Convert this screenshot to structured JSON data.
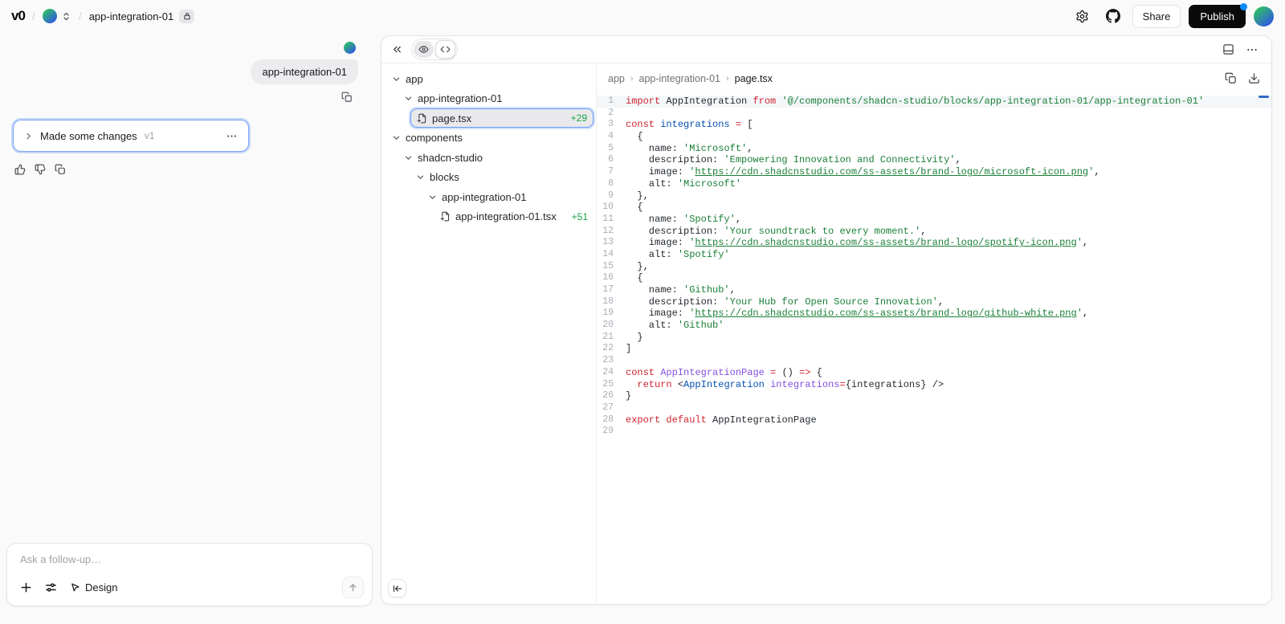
{
  "topbar": {
    "logo": "v0",
    "slash": "/",
    "project_name": "app-integration-01",
    "share_label": "Share",
    "publish_label": "Publish"
  },
  "chat": {
    "user_message": "app-integration-01",
    "version_card": {
      "title": "Made some changes",
      "version": "v1"
    },
    "composer": {
      "placeholder": "Ask a follow-up…",
      "design_label": "Design"
    }
  },
  "workspace": {
    "tree": [
      {
        "label": "app",
        "type": "folder",
        "depth": 0
      },
      {
        "label": "app-integration-01",
        "type": "folder",
        "depth": 1
      },
      {
        "label": "page.tsx",
        "type": "file",
        "depth": 2,
        "badge": "+29",
        "selected": true
      },
      {
        "label": "components",
        "type": "folder",
        "depth": 0
      },
      {
        "label": "shadcn-studio",
        "type": "folder",
        "depth": 1
      },
      {
        "label": "blocks",
        "type": "folder",
        "depth": 2
      },
      {
        "label": "app-integration-01",
        "type": "folder",
        "depth": 3
      },
      {
        "label": "app-integration-01.tsx",
        "type": "file",
        "depth": 4,
        "badge": "+51",
        "selected": false
      }
    ],
    "breadcrumb": {
      "segments": [
        "app",
        "app-integration-01",
        "page.tsx"
      ],
      "separator": "›"
    },
    "code": {
      "lines": [
        [
          [
            "k",
            "import"
          ],
          [
            "p",
            " AppIntegration "
          ],
          [
            "k",
            "from"
          ],
          [
            "p",
            " "
          ],
          [
            "s",
            "'@/components/shadcn-studio/blocks/app-integration-01/app-integration-01'"
          ]
        ],
        [],
        [
          [
            "k",
            "const"
          ],
          [
            "p",
            " "
          ],
          [
            "v",
            "integrations"
          ],
          [
            "p",
            " "
          ],
          [
            "k",
            "="
          ],
          [
            "p",
            " ["
          ]
        ],
        [
          [
            "p",
            "  {"
          ]
        ],
        [
          [
            "p",
            "    name: "
          ],
          [
            "s",
            "'Microsoft'"
          ],
          [
            "p",
            ","
          ]
        ],
        [
          [
            "p",
            "    description: "
          ],
          [
            "s",
            "'Empowering Innovation and Connectivity'"
          ],
          [
            "p",
            ","
          ]
        ],
        [
          [
            "p",
            "    image: "
          ],
          [
            "s",
            "'"
          ],
          [
            "u",
            "https://cdn.shadcnstudio.com/ss-assets/brand-logo/microsoft-icon.png"
          ],
          [
            "s",
            "'"
          ],
          [
            "p",
            ","
          ]
        ],
        [
          [
            "p",
            "    alt: "
          ],
          [
            "s",
            "'Microsoft'"
          ]
        ],
        [
          [
            "p",
            "  },"
          ]
        ],
        [
          [
            "p",
            "  {"
          ]
        ],
        [
          [
            "p",
            "    name: "
          ],
          [
            "s",
            "'Spotify'"
          ],
          [
            "p",
            ","
          ]
        ],
        [
          [
            "p",
            "    description: "
          ],
          [
            "s",
            "'Your soundtrack to every moment.'"
          ],
          [
            "p",
            ","
          ]
        ],
        [
          [
            "p",
            "    image: "
          ],
          [
            "s",
            "'"
          ],
          [
            "u",
            "https://cdn.shadcnstudio.com/ss-assets/brand-logo/spotify-icon.png"
          ],
          [
            "s",
            "'"
          ],
          [
            "p",
            ","
          ]
        ],
        [
          [
            "p",
            "    alt: "
          ],
          [
            "s",
            "'Spotify'"
          ]
        ],
        [
          [
            "p",
            "  },"
          ]
        ],
        [
          [
            "p",
            "  {"
          ]
        ],
        [
          [
            "p",
            "    name: "
          ],
          [
            "s",
            "'Github'"
          ],
          [
            "p",
            ","
          ]
        ],
        [
          [
            "p",
            "    description: "
          ],
          [
            "s",
            "'Your Hub for Open Source Innovation'"
          ],
          [
            "p",
            ","
          ]
        ],
        [
          [
            "p",
            "    image: "
          ],
          [
            "s",
            "'"
          ],
          [
            "u",
            "https://cdn.shadcnstudio.com/ss-assets/brand-logo/github-white.png"
          ],
          [
            "s",
            "'"
          ],
          [
            "p",
            ","
          ]
        ],
        [
          [
            "p",
            "    alt: "
          ],
          [
            "s",
            "'Github'"
          ]
        ],
        [
          [
            "p",
            "  }"
          ]
        ],
        [
          [
            "p",
            "]"
          ]
        ],
        [],
        [
          [
            "k",
            "const"
          ],
          [
            "p",
            " "
          ],
          [
            "f",
            "AppIntegrationPage"
          ],
          [
            "p",
            " "
          ],
          [
            "k",
            "="
          ],
          [
            "p",
            " () "
          ],
          [
            "k",
            "=>"
          ],
          [
            "p",
            " {"
          ]
        ],
        [
          [
            "p",
            "  "
          ],
          [
            "k",
            "return"
          ],
          [
            "p",
            " <"
          ],
          [
            "v",
            "AppIntegration"
          ],
          [
            "p",
            " "
          ],
          [
            "f",
            "integrations"
          ],
          [
            "k",
            "="
          ],
          [
            "p",
            "{integrations} />"
          ]
        ],
        [
          [
            "p",
            "}"
          ]
        ],
        [],
        [
          [
            "k",
            "export"
          ],
          [
            "p",
            " "
          ],
          [
            "k",
            "default"
          ],
          [
            "p",
            " AppIntegrationPage"
          ]
        ],
        []
      ]
    }
  },
  "colors": {
    "accent_blue": "#3b82f6",
    "diff_green": "#16a34a",
    "keyword_red": "#cf222e",
    "string_green": "#1a7f37",
    "variable_blue": "#0550ae",
    "function_purple": "#8250df",
    "avatar_gradient_start": "#2fbe66",
    "avatar_gradient_end": "#2f5bde"
  }
}
